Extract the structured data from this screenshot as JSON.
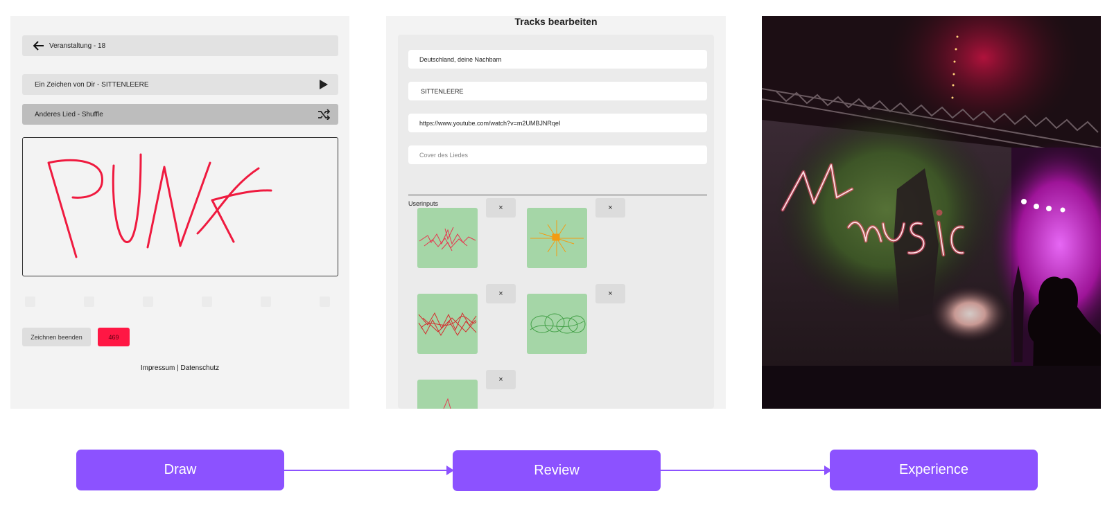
{
  "draw_screen": {
    "back_label": "Veranstaltung - 18",
    "current_track": "Ein Zeichen von Dir - SITTENLEERE",
    "shuffle_label": "Anderes Lied - Shuffle",
    "drawing_text": "PUNK",
    "stroke_color": "#ef1a3f",
    "finish_button": "Zeichnen beenden",
    "counter": "469",
    "footer_imprint": "Impressum",
    "footer_separator": " | ",
    "footer_privacy": "Datenschutz"
  },
  "review_screen": {
    "title": "Tracks bearbeiten",
    "fields": {
      "field1": "Deutschland, deine Nachbarn",
      "field2": "SITTENLEERE",
      "url": "https://www.youtube.com/watch?v=m2UMBJNRqeI",
      "cover_placeholder": "Cover des Liedes"
    },
    "userinputs_label": "Userinputs",
    "remove_label": "×"
  },
  "experience_photo": {
    "projection_text": "M-music",
    "colors": {
      "neon": "#ff3355",
      "stage": "#e040fb"
    }
  },
  "flow": {
    "step1": "Draw",
    "step2": "Review",
    "step3": "Experience",
    "color": "#8c52ff"
  }
}
